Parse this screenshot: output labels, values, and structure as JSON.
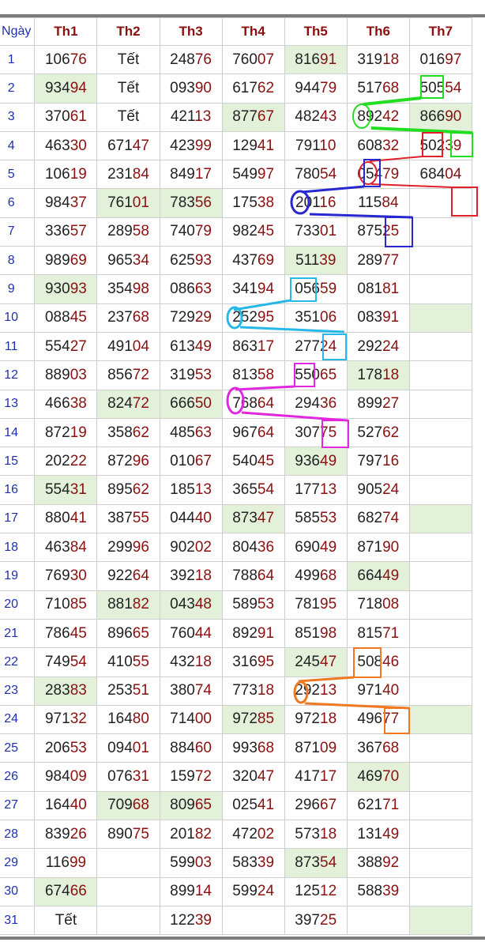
{
  "table": {
    "day_header": "Ngày",
    "headers": [
      "Th1",
      "Th2",
      "Th3",
      "Th4",
      "Th5",
      "Th6",
      "Th7"
    ],
    "rows": [
      {
        "day": "1",
        "cells": [
          {
            "v": "10676"
          },
          {
            "v": "Tết"
          },
          {
            "v": "24876"
          },
          {
            "v": "76007"
          },
          {
            "v": "81691",
            "hl": true
          },
          {
            "v": "31918"
          },
          {
            "v": "01697"
          }
        ]
      },
      {
        "day": "2",
        "cells": [
          {
            "v": "93494",
            "hl": true
          },
          {
            "v": "Tết"
          },
          {
            "v": "09390"
          },
          {
            "v": "61762"
          },
          {
            "v": "94479"
          },
          {
            "v": "51768"
          },
          {
            "v": "50554"
          }
        ]
      },
      {
        "day": "3",
        "cells": [
          {
            "v": "37061"
          },
          {
            "v": "Tết"
          },
          {
            "v": "42113"
          },
          {
            "v": "87767",
            "hl": true
          },
          {
            "v": "48243"
          },
          {
            "v": "89242"
          },
          {
            "v": "86690",
            "hl": true
          }
        ]
      },
      {
        "day": "4",
        "cells": [
          {
            "v": "46330"
          },
          {
            "v": "67147"
          },
          {
            "v": "42399"
          },
          {
            "v": "12941"
          },
          {
            "v": "79110"
          },
          {
            "v": "60832"
          },
          {
            "v": "50239"
          }
        ]
      },
      {
        "day": "5",
        "cells": [
          {
            "v": "10619"
          },
          {
            "v": "23184"
          },
          {
            "v": "84917"
          },
          {
            "v": "54997"
          },
          {
            "v": "78054"
          },
          {
            "v": "05479"
          },
          {
            "v": "68404"
          }
        ]
      },
      {
        "day": "6",
        "cells": [
          {
            "v": "98437"
          },
          {
            "v": "76101",
            "hl": true
          },
          {
            "v": "78356",
            "hl": true
          },
          {
            "v": "17538"
          },
          {
            "v": "20116"
          },
          {
            "v": "11584"
          },
          {
            "v": ""
          }
        ]
      },
      {
        "day": "7",
        "cells": [
          {
            "v": "33657"
          },
          {
            "v": "28958"
          },
          {
            "v": "74079"
          },
          {
            "v": "98245"
          },
          {
            "v": "73301"
          },
          {
            "v": "87525"
          },
          {
            "v": ""
          }
        ]
      },
      {
        "day": "8",
        "cells": [
          {
            "v": "98969"
          },
          {
            "v": "96534"
          },
          {
            "v": "62593"
          },
          {
            "v": "43769"
          },
          {
            "v": "51139",
            "hl": true
          },
          {
            "v": "28977"
          },
          {
            "v": ""
          }
        ]
      },
      {
        "day": "9",
        "cells": [
          {
            "v": "93093",
            "hl": true
          },
          {
            "v": "35498"
          },
          {
            "v": "08663"
          },
          {
            "v": "34194"
          },
          {
            "v": "05659"
          },
          {
            "v": "08181"
          },
          {
            "v": ""
          }
        ]
      },
      {
        "day": "10",
        "cells": [
          {
            "v": "08845"
          },
          {
            "v": "23768"
          },
          {
            "v": "72929"
          },
          {
            "v": "25295"
          },
          {
            "v": "35106"
          },
          {
            "v": "08391"
          },
          {
            "v": "",
            "hl": true
          }
        ]
      },
      {
        "day": "11",
        "cells": [
          {
            "v": "55427"
          },
          {
            "v": "49104"
          },
          {
            "v": "61349"
          },
          {
            "v": "86317"
          },
          {
            "v": "27724"
          },
          {
            "v": "29224"
          },
          {
            "v": ""
          }
        ]
      },
      {
        "day": "12",
        "cells": [
          {
            "v": "88903"
          },
          {
            "v": "85672"
          },
          {
            "v": "31953"
          },
          {
            "v": "81358"
          },
          {
            "v": "55065"
          },
          {
            "v": "17818",
            "hl": true
          },
          {
            "v": ""
          }
        ]
      },
      {
        "day": "13",
        "cells": [
          {
            "v": "46638"
          },
          {
            "v": "82472",
            "hl": true
          },
          {
            "v": "66650",
            "hl": true
          },
          {
            "v": "76864"
          },
          {
            "v": "29436"
          },
          {
            "v": "89927"
          },
          {
            "v": ""
          }
        ]
      },
      {
        "day": "14",
        "cells": [
          {
            "v": "87219"
          },
          {
            "v": "35862"
          },
          {
            "v": "48563"
          },
          {
            "v": "96764"
          },
          {
            "v": "30775"
          },
          {
            "v": "52762"
          },
          {
            "v": ""
          }
        ]
      },
      {
        "day": "15",
        "cells": [
          {
            "v": "20222"
          },
          {
            "v": "87296"
          },
          {
            "v": "01067"
          },
          {
            "v": "54045"
          },
          {
            "v": "93649",
            "hl": true
          },
          {
            "v": "79716"
          },
          {
            "v": ""
          }
        ]
      },
      {
        "day": "16",
        "cells": [
          {
            "v": "55431",
            "hl": true
          },
          {
            "v": "89562"
          },
          {
            "v": "18513"
          },
          {
            "v": "36554"
          },
          {
            "v": "17713"
          },
          {
            "v": "90524"
          },
          {
            "v": ""
          }
        ]
      },
      {
        "day": "17",
        "cells": [
          {
            "v": "88041"
          },
          {
            "v": "38755"
          },
          {
            "v": "04440"
          },
          {
            "v": "87347",
            "hl": true
          },
          {
            "v": "58553"
          },
          {
            "v": "68274"
          },
          {
            "v": "",
            "hl": true
          }
        ]
      },
      {
        "day": "18",
        "cells": [
          {
            "v": "46384"
          },
          {
            "v": "29996"
          },
          {
            "v": "90202"
          },
          {
            "v": "80436"
          },
          {
            "v": "69049"
          },
          {
            "v": "87190"
          },
          {
            "v": ""
          }
        ]
      },
      {
        "day": "19",
        "cells": [
          {
            "v": "76930"
          },
          {
            "v": "92264"
          },
          {
            "v": "39218"
          },
          {
            "v": "78864"
          },
          {
            "v": "49968"
          },
          {
            "v": "66449",
            "hl": true
          },
          {
            "v": ""
          }
        ]
      },
      {
        "day": "20",
        "cells": [
          {
            "v": "71085"
          },
          {
            "v": "88182",
            "hl": true
          },
          {
            "v": "04348",
            "hl": true
          },
          {
            "v": "58953"
          },
          {
            "v": "78195"
          },
          {
            "v": "71808"
          },
          {
            "v": ""
          }
        ]
      },
      {
        "day": "21",
        "cells": [
          {
            "v": "78645"
          },
          {
            "v": "89665"
          },
          {
            "v": "76044"
          },
          {
            "v": "89291"
          },
          {
            "v": "85198"
          },
          {
            "v": "81571"
          },
          {
            "v": ""
          }
        ]
      },
      {
        "day": "22",
        "cells": [
          {
            "v": "74954"
          },
          {
            "v": "41055"
          },
          {
            "v": "43218"
          },
          {
            "v": "31695"
          },
          {
            "v": "24547",
            "hl": true
          },
          {
            "v": "50846"
          },
          {
            "v": ""
          }
        ]
      },
      {
        "day": "23",
        "cells": [
          {
            "v": "28383",
            "hl": true
          },
          {
            "v": "25351"
          },
          {
            "v": "38074"
          },
          {
            "v": "77318"
          },
          {
            "v": "29213"
          },
          {
            "v": "97140"
          },
          {
            "v": ""
          }
        ]
      },
      {
        "day": "24",
        "cells": [
          {
            "v": "97132"
          },
          {
            "v": "16480"
          },
          {
            "v": "71400"
          },
          {
            "v": "97285",
            "hl": true
          },
          {
            "v": "97218"
          },
          {
            "v": "49677"
          },
          {
            "v": "",
            "hl": true
          }
        ]
      },
      {
        "day": "25",
        "cells": [
          {
            "v": "20653"
          },
          {
            "v": "09401"
          },
          {
            "v": "88460"
          },
          {
            "v": "99368"
          },
          {
            "v": "87109"
          },
          {
            "v": "36768"
          },
          {
            "v": ""
          }
        ]
      },
      {
        "day": "26",
        "cells": [
          {
            "v": "98409"
          },
          {
            "v": "07631"
          },
          {
            "v": "15972"
          },
          {
            "v": "32047"
          },
          {
            "v": "41717"
          },
          {
            "v": "46970",
            "hl": true
          },
          {
            "v": ""
          }
        ]
      },
      {
        "day": "27",
        "cells": [
          {
            "v": "16440"
          },
          {
            "v": "70968",
            "hl": true
          },
          {
            "v": "80965",
            "hl": true
          },
          {
            "v": "02541"
          },
          {
            "v": "29667"
          },
          {
            "v": "62171"
          },
          {
            "v": ""
          }
        ]
      },
      {
        "day": "28",
        "cells": [
          {
            "v": "83926"
          },
          {
            "v": "89075"
          },
          {
            "v": "20182"
          },
          {
            "v": "47202"
          },
          {
            "v": "57318"
          },
          {
            "v": "13149"
          },
          {
            "v": ""
          }
        ]
      },
      {
        "day": "29",
        "cells": [
          {
            "v": "11699"
          },
          {
            "v": ""
          },
          {
            "v": "59903"
          },
          {
            "v": "58339"
          },
          {
            "v": "87354",
            "hl": true
          },
          {
            "v": "38892"
          },
          {
            "v": ""
          }
        ]
      },
      {
        "day": "30",
        "cells": [
          {
            "v": "67466",
            "hl": true
          },
          {
            "v": ""
          },
          {
            "v": "89914"
          },
          {
            "v": "59924"
          },
          {
            "v": "12512"
          },
          {
            "v": "58839"
          },
          {
            "v": ""
          }
        ]
      },
      {
        "day": "31",
        "cells": [
          {
            "v": "Tết"
          },
          {
            "v": ""
          },
          {
            "v": "12239"
          },
          {
            "v": ""
          },
          {
            "v": "39725"
          },
          {
            "v": ""
          },
          {
            "v": "",
            "hl": true
          }
        ]
      }
    ]
  },
  "colors": {
    "highlight_bg": "#e3f1da",
    "prefix_digits": "#222222",
    "suffix_digits": "#8b1010",
    "day_numbers": "#1f2fb0",
    "annotation_green": "#22dd22",
    "annotation_red": "#e0202a",
    "annotation_blue": "#2828d0",
    "annotation_cyan": "#28b8e8",
    "annotation_magenta": "#e028e0",
    "annotation_orange": "#f07820"
  }
}
